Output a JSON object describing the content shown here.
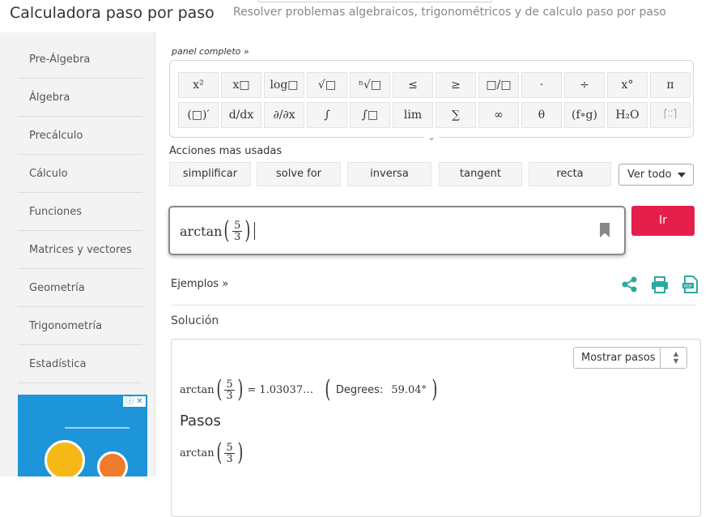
{
  "header": {
    "title": "Calculadora paso por paso",
    "subtitle": "Resolver problemas algebraicos, trigonométricos y de calculo paso por paso"
  },
  "sidebar": {
    "items": [
      {
        "label": "Pre-Álgebra"
      },
      {
        "label": "Álgebra"
      },
      {
        "label": "Precálculo"
      },
      {
        "label": "Cálculo"
      },
      {
        "label": "Funciones"
      },
      {
        "label": "Matrices y vectores"
      },
      {
        "label": "Geometría"
      },
      {
        "label": "Trigonometría"
      },
      {
        "label": "Estadística"
      }
    ]
  },
  "ad": {
    "close_label": "ⓘ ✕"
  },
  "keypad": {
    "panel_link": "panel completo »",
    "row1": [
      "x²",
      "x□",
      "log□",
      "√□",
      "ⁿ√□",
      "≤",
      "≥",
      "□/□",
      "·",
      "÷",
      "x°",
      "π"
    ],
    "row2": [
      "(□)′",
      "d/dx",
      "∂/∂x",
      "∫",
      "∫□",
      "lim",
      "∑",
      "∞",
      "θ",
      "(f∘g)",
      "H₂O",
      "matrix"
    ]
  },
  "actions": {
    "label": "Acciones mas usadas",
    "buttons": [
      "simplificar",
      "solve for",
      "inversa",
      "tangent",
      "recta"
    ],
    "dropdown": "Ver todo"
  },
  "input": {
    "func": "arctan",
    "num": "5",
    "den": "3"
  },
  "go_label": "Ir",
  "examples_label": "Ejemplos »",
  "icons": {
    "share": "share-icon",
    "print": "print-icon",
    "pdf": "pdf-icon",
    "bookmark": "bookmark-icon",
    "accent": "#2aa9a0",
    "go_color": "#e51f4b"
  },
  "solution": {
    "heading": "Solución",
    "mostrar_label": "Mostrar pasos",
    "result": {
      "func": "arctan",
      "num": "5",
      "den": "3",
      "equals": "= 1.03037…",
      "degrees_label": "Degrees:",
      "degrees_value": "59.04°"
    },
    "steps_heading": "Pasos",
    "step1": {
      "func": "arctan",
      "num": "5",
      "den": "3"
    }
  }
}
